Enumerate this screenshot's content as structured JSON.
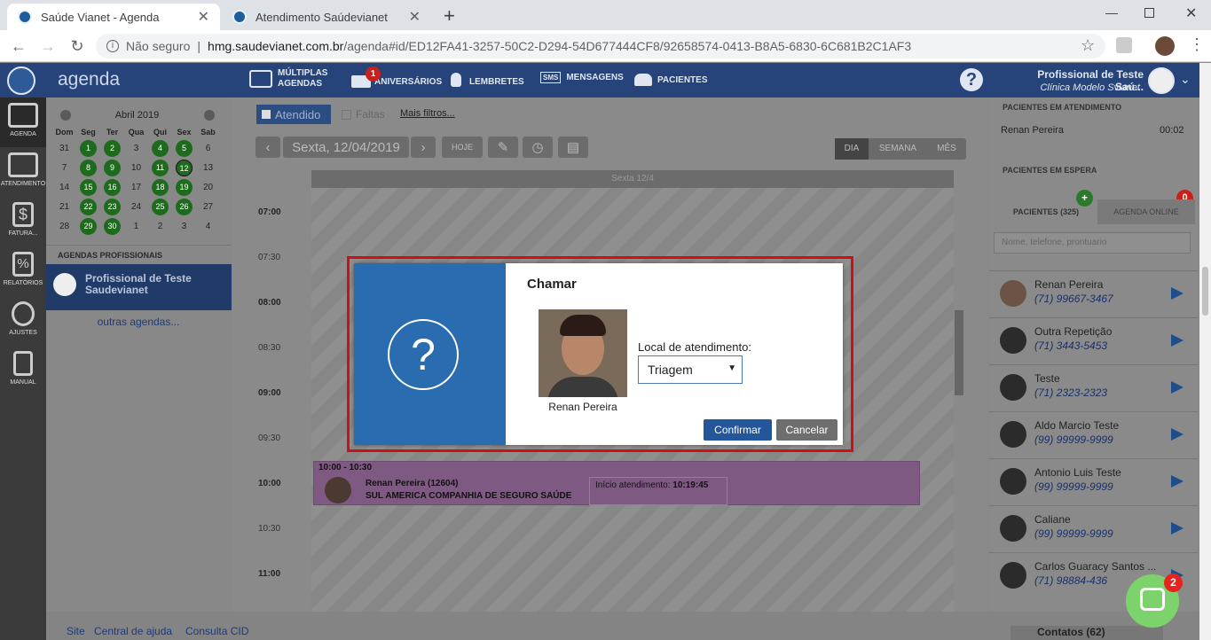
{
  "browser": {
    "tabs": [
      {
        "title": "Saúde Vianet - Agenda",
        "active": true
      },
      {
        "title": "Atendimento Saúdevianet",
        "active": false
      }
    ],
    "new_tab": "+",
    "security": "Não seguro",
    "url_host": "hmg.saudevianet.com.br",
    "url_path": "/agenda#id/ED12FA41-3257-50C2-D294-54D677444CF8/92658574-0413-B8A5-6830-6C681B2C1AF3"
  },
  "header": {
    "app_name": "agenda",
    "nav": [
      {
        "label": "MÚLTIPLAS AGENDAS"
      },
      {
        "label": "ANIVERSÁRIOS",
        "badge": "1"
      },
      {
        "label": "LEMBRETES"
      },
      {
        "label": "MENSAGENS",
        "icon_text": "SMS"
      },
      {
        "label": "PACIENTES"
      }
    ],
    "help": "?",
    "user_name": "Profissional de Teste Saú...",
    "clinic": "Clínica Modelo Svianet"
  },
  "sidebar": {
    "items": [
      {
        "label": "AGENDA"
      },
      {
        "label": "ATENDIMENTO"
      },
      {
        "label": "FATURA..."
      },
      {
        "label": "RELATÓRIOS"
      },
      {
        "label": "AJUSTES"
      },
      {
        "label": "MANUAL"
      }
    ]
  },
  "calendar": {
    "month": "Abril 2019",
    "weekdays": [
      "Dom",
      "Seg",
      "Ter",
      "Qua",
      "Qui",
      "Sex",
      "Sab"
    ],
    "weeks": [
      [
        "31",
        "1",
        "2",
        "3",
        "4",
        "5",
        "6"
      ],
      [
        "7",
        "8",
        "9",
        "10",
        "11",
        "12",
        "13"
      ],
      [
        "14",
        "15",
        "16",
        "17",
        "18",
        "19",
        "20"
      ],
      [
        "21",
        "22",
        "23",
        "24",
        "25",
        "26",
        "27"
      ],
      [
        "28",
        "29",
        "30",
        "1",
        "2",
        "3",
        "4"
      ]
    ],
    "marked": [
      "1",
      "2",
      "4",
      "5",
      "8",
      "9",
      "11",
      "12",
      "15",
      "16",
      "18",
      "19",
      "22",
      "23",
      "25",
      "26",
      "29",
      "30"
    ],
    "agendas_title": "AGENDAS PROFISSIONAIS",
    "professional": "Profissional de Teste Saudevianet",
    "other_agendas": "outras agendas..."
  },
  "filters": {
    "attended": "Atendido",
    "missed": "Faltas",
    "more": "Mais filtros..."
  },
  "toolbar": {
    "date": "Sexta, 12/04/2019",
    "today": "HOJE",
    "views": [
      "DIA",
      "SEMANA",
      "MÊS"
    ]
  },
  "day_header": "Sexta 12/4",
  "hours": [
    "07:00",
    "07:30",
    "08:00",
    "08:30",
    "09:00",
    "09:30",
    "10:00",
    "10:30",
    "11:00"
  ],
  "appointment": {
    "time": "10:00 - 10:30",
    "patient": "Renan Pereira (12604)",
    "insurer": "SUL AMERICA COMPANHIA DE SEGURO SAÚDE",
    "start_label": "Início atendimento:",
    "start_time": "10:19:45"
  },
  "right_panel": {
    "in_service_title": "PACIENTES EM ATENDIMENTO",
    "in_service": {
      "name": "Renan Pereira",
      "time": "00:02"
    },
    "waiting_title": "PACIENTES EM ESPERA",
    "tabs": [
      "PACIENTES (325)",
      "AGENDA ONLINE"
    ],
    "add_badge": "+",
    "online_badge": "0",
    "search_placeholder": "Nome, telefone, prontuario",
    "patients": [
      {
        "name": "Renan Pereira",
        "phone": "(71) 99667-3467"
      },
      {
        "name": "Outra Repetição",
        "phone": "(71) 3443-5453"
      },
      {
        "name": "Teste",
        "phone": "(71) 2323-2323"
      },
      {
        "name": "Aldo Marcio Teste",
        "phone": "(99) 99999-9999"
      },
      {
        "name": "Antonio Luis Teste",
        "phone": "(99) 99999-9999"
      },
      {
        "name": "Caliane",
        "phone": "(99) 99999-9999"
      },
      {
        "name": "Carlos Guaracy Santos ...",
        "phone": "(71) 98884-436"
      }
    ]
  },
  "footer": {
    "links": [
      "Site",
      "Central de ajuda",
      "Consulta CID"
    ],
    "contacts": "Contatos (62)"
  },
  "chat_badge": "2",
  "modal": {
    "title": "Chamar",
    "patient_name": "Renan Pereira",
    "location_label": "Local de atendimento:",
    "location_value": "Triagem",
    "confirm": "Confirmar",
    "cancel": "Cancelar",
    "question_mark": "?"
  }
}
